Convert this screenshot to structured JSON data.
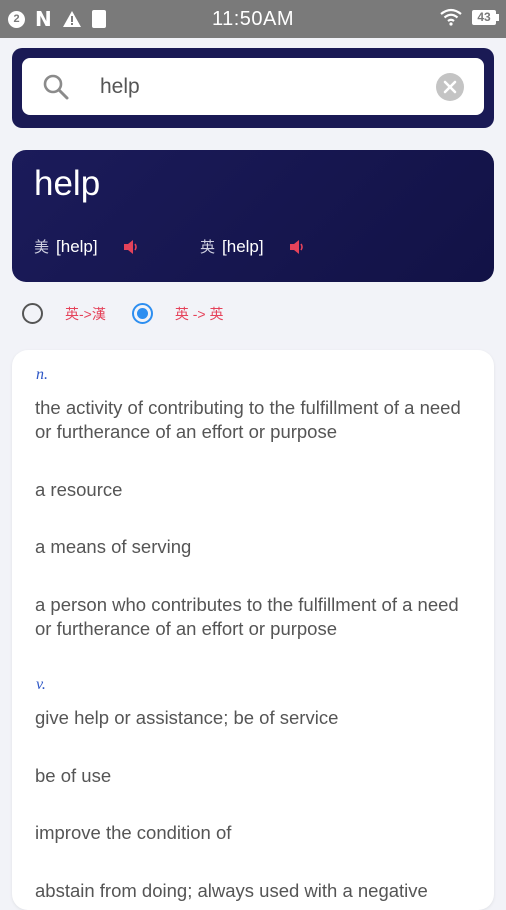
{
  "status_bar": {
    "notification_count": "2",
    "time": "11:50AM",
    "battery": "43"
  },
  "search": {
    "value": "help"
  },
  "word": {
    "headword": "help",
    "us_label": "美",
    "us_phonetic": "[help]",
    "uk_label": "英",
    "uk_phonetic": "[help]"
  },
  "mode": {
    "option1": "英->漢",
    "option2": "英 -> 英",
    "selected": "英 -> 英"
  },
  "definitions": {
    "noun_pos": "n.",
    "noun": [
      "the activity of contributing to the fulfillment of a need or furtherance of an effort or purpose",
      "a resource",
      "a means of serving",
      "a person who contributes to the fulfillment of a need or furtherance of an effort or purpose"
    ],
    "verb_pos": "v.",
    "verb": [
      "give help or assistance; be of service",
      "be of use",
      "improve the condition of",
      "abstain from doing; always used with a negative"
    ]
  },
  "colors": {
    "accent_navy": "#1a1a55",
    "radio_blue": "#2d8ef0",
    "label_red": "#e5425a",
    "pos_blue": "#2e57c6"
  }
}
